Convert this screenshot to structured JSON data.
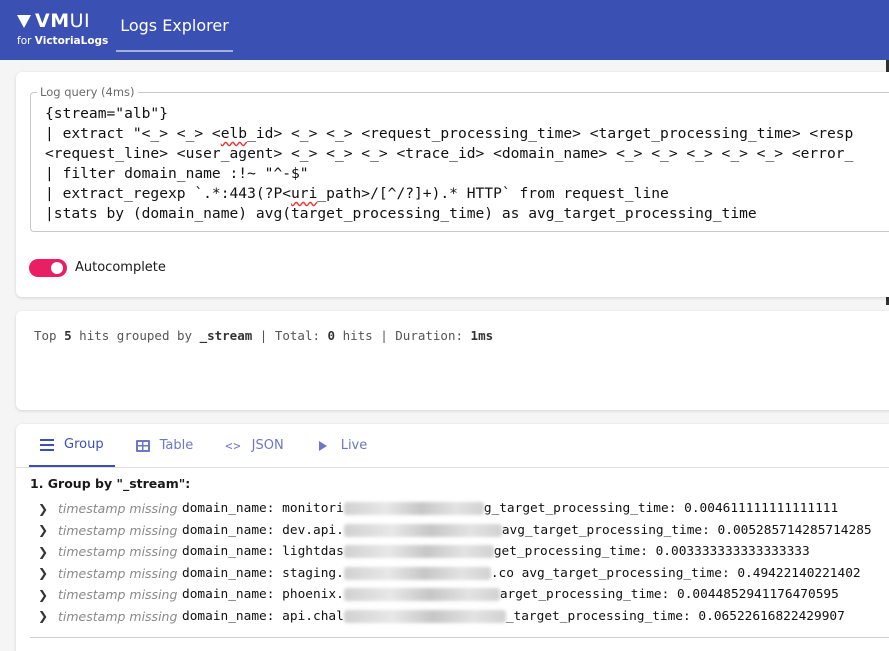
{
  "app": {
    "logo_main": "VM",
    "logo_ui": "UI",
    "logo_sub_prefix": "for ",
    "logo_sub_brand": "VictoriaLogs",
    "nav_tab": "Logs Explorer",
    "accent_color": "#3b50b3",
    "toggle_color": "#e91e63"
  },
  "query": {
    "label": "Log query (4ms)",
    "lines": [
      "{stream=\"alb\"}",
      "| extract \"<_> <_> <elb_id> <_> <_> <request_processing_time> <target_processing_time> <resp",
      "<request_line> <user_agent> <_> <_> <_> <trace_id> <domain_name> <_> <_> <_> <_> <_> <error_",
      "| filter domain_name :!~ \"^-$\"",
      "| extract_regexp `.*:443(?P<uri_path>/[^/?]+).* HTTP` from request_line",
      "|stats by (domain_name) avg(target_processing_time) as avg_target_processing_time"
    ],
    "autocomplete_label": "Autocomplete",
    "autocomplete_on": true
  },
  "stats": {
    "prefix": "Top ",
    "top_n": "5",
    "mid": " hits grouped by ",
    "group_field": "_stream",
    "sep1": " | Total: ",
    "total": "0",
    "hits_word": " hits",
    "sep2": " | Duration: ",
    "duration": "1ms"
  },
  "tabs": [
    {
      "label": "Group",
      "icon": "list-icon",
      "active": true
    },
    {
      "label": "Table",
      "icon": "table-icon",
      "active": false
    },
    {
      "label": "JSON",
      "icon": "code-icon",
      "active": false
    },
    {
      "label": "Live",
      "icon": "play-icon",
      "active": false
    }
  ],
  "results": {
    "group_title": "1. Group by \"_stream\":",
    "rows": [
      {
        "timestamp": "timestamp missing",
        "key": "domain_name:",
        "domain_visible": "monitori",
        "tail": "g_target_processing_time: 0.004611111111111111"
      },
      {
        "timestamp": "timestamp missing",
        "key": "domain_name:",
        "domain_visible": "dev.api.",
        "tail": " avg_target_processing_time: 0.005285714285714285"
      },
      {
        "timestamp": "timestamp missing",
        "key": "domain_name:",
        "domain_visible": "lightdas",
        "tail": "get_processing_time: 0.003333333333333333"
      },
      {
        "timestamp": "timestamp missing",
        "key": "domain_name:",
        "domain_visible": "staging.",
        "tail": ".co  avg_target_processing_time: 0.49422140221402"
      },
      {
        "timestamp": "timestamp missing",
        "key": "domain_name:",
        "domain_visible": "phoenix.",
        "tail": "arget_processing_time: 0.0044852941176470595"
      },
      {
        "timestamp": "timestamp missing",
        "key": "domain_name:",
        "domain_visible": "api.chal",
        "tail": "_target_processing_time: 0.06522616822429907"
      }
    ]
  }
}
